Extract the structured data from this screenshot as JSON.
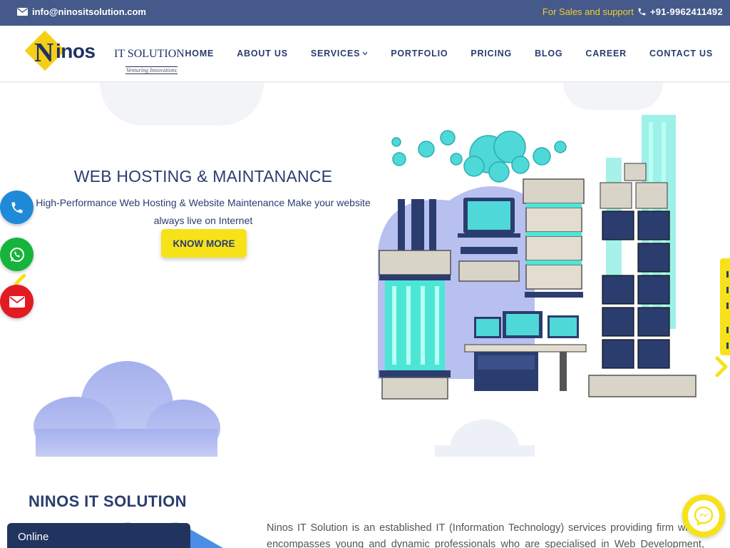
{
  "topbar": {
    "email": "info@ninositsolution.com",
    "sales_label": "For Sales and support",
    "phone": "+91-9962411492",
    "email_icon": "envelope-icon",
    "phone_icon": "phone-icon"
  },
  "logo": {
    "letter": "N",
    "word": "inos",
    "suffix": "IT SOLUTION",
    "tagline": "Venturing Innovations"
  },
  "nav": {
    "items": [
      {
        "label": "HOME"
      },
      {
        "label": "ABOUT US"
      },
      {
        "label": "SERVICES",
        "dropdown": true
      },
      {
        "label": "PORTFOLIO"
      },
      {
        "label": "PRICING"
      },
      {
        "label": "BLOG"
      },
      {
        "label": "CAREER"
      },
      {
        "label": "CONTACT US"
      }
    ]
  },
  "hero": {
    "title": "WEB HOSTING & MAINTANANCE",
    "subtitle": "High-Performance Web Hosting & Website Maintenance  Make your website always live on Internet",
    "button_label": "KNOW MORE"
  },
  "floating": {
    "phone_icon": "phone-icon",
    "whatsapp_icon": "whatsapp-icon",
    "mail_icon": "envelope-icon"
  },
  "about": {
    "title": "NINOS IT SOLUTION",
    "text": "Ninos IT Solution is an established IT (Information Technology) services providing firm which encompasses young and dynamic professionals who are specialised in Web Development, Mobile"
  },
  "chat": {
    "status": "Online"
  },
  "colors": {
    "topbar": "#45598a",
    "navy": "#2a3d6e",
    "accent_yellow": "#f7e21a",
    "sales_yellow": "#f2cf2e",
    "phone_blue": "#1e8ad8",
    "whatsapp_green": "#16b43a",
    "mail_red": "#e21b23"
  }
}
